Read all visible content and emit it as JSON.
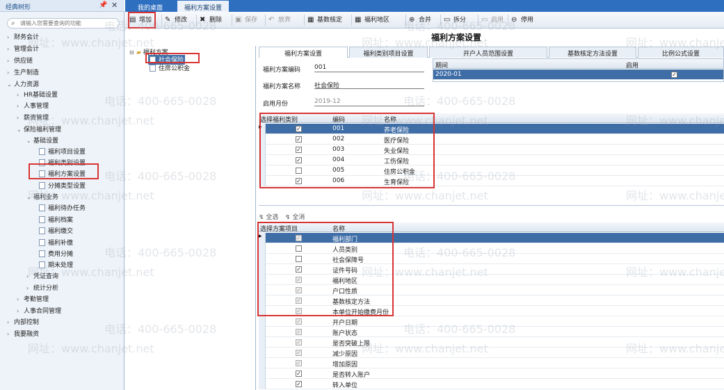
{
  "left_panel": {
    "title": "经典树形",
    "pin_icon": "pin-icon",
    "close_icon": "close-icon",
    "search_placeholder": "请输入您需要查询的功能",
    "tree": [
      {
        "label": "财务会计",
        "arrow": "›"
      },
      {
        "label": "管理会计",
        "arrow": "›"
      },
      {
        "label": "供应链",
        "arrow": "›"
      },
      {
        "label": "生产制造",
        "arrow": "›"
      },
      {
        "label": "人力资源",
        "arrow": "⌄"
      },
      {
        "label": "HR基础设置",
        "arrow": "›"
      },
      {
        "label": "人事管理",
        "arrow": "›"
      },
      {
        "label": "薪资管理",
        "arrow": "›"
      },
      {
        "label": "保险福利管理",
        "arrow": "⌄"
      },
      {
        "label": "基础设置",
        "arrow": "⌄"
      },
      {
        "label": "福利项目设置",
        "arrow": ""
      },
      {
        "label": "福利类别设置",
        "arrow": ""
      },
      {
        "label": "福利方案设置",
        "arrow": ""
      },
      {
        "label": "分摊类型设置",
        "arrow": ""
      },
      {
        "label": "福利业务",
        "arrow": "⌄"
      },
      {
        "label": "福利待办任务",
        "arrow": ""
      },
      {
        "label": "福利档案",
        "arrow": ""
      },
      {
        "label": "福利缴交",
        "arrow": ""
      },
      {
        "label": "福利补缴",
        "arrow": ""
      },
      {
        "label": "费用分摊",
        "arrow": ""
      },
      {
        "label": "期末处理",
        "arrow": ""
      },
      {
        "label": "凭证查询",
        "arrow": "›"
      },
      {
        "label": "统计分析",
        "arrow": "›"
      },
      {
        "label": "考勤管理",
        "arrow": "›"
      },
      {
        "label": "人事合同管理",
        "arrow": "›"
      },
      {
        "label": "内部控制",
        "arrow": "›"
      },
      {
        "label": "我要融资",
        "arrow": "›"
      }
    ]
  },
  "tabs": [
    "我的桌面",
    "福利方案设置"
  ],
  "toolbar": [
    {
      "label": "增加",
      "icon": "add-icon",
      "glyph": "▤",
      "enabled": true
    },
    {
      "label": "修改",
      "icon": "edit-icon",
      "glyph": "✎",
      "enabled": true
    },
    {
      "label": "删除",
      "icon": "delete-icon",
      "glyph": "✖",
      "enabled": true
    },
    {
      "label": "保存",
      "icon": "save-icon",
      "glyph": "▣",
      "enabled": false
    },
    {
      "label": "放弃",
      "icon": "discard-icon",
      "glyph": "↶",
      "enabled": false
    },
    {
      "label": "基数核定",
      "icon": "base-check-icon",
      "glyph": "▦",
      "enabled": true
    },
    {
      "label": "福利地区",
      "icon": "region-icon",
      "glyph": "▦",
      "enabled": true
    },
    {
      "label": "合并",
      "icon": "merge-icon",
      "glyph": "⊕",
      "enabled": true
    },
    {
      "label": "拆分",
      "icon": "split-icon",
      "glyph": "▭",
      "enabled": true
    },
    {
      "label": "启用",
      "icon": "enable-icon",
      "glyph": "▭",
      "enabled": false
    },
    {
      "label": "停用",
      "icon": "disable-icon",
      "glyph": "⊖",
      "enabled": true
    }
  ],
  "scheme_tree": {
    "root": "福利方案",
    "children": [
      "社会保险",
      "住房公积金"
    ]
  },
  "page_title": "福利方案设置",
  "sub_tabs": [
    "福利方案设置",
    "福利类别项目设置",
    "开户人员范围设置",
    "基数核定方法设置",
    "比例公式设置"
  ],
  "form": {
    "code_label": "福利方案编码",
    "code_value": "001",
    "name_label": "福利方案名称",
    "name_value": "社会保险",
    "month_label": "启用月份",
    "month_value": "2019-12"
  },
  "period_grid": {
    "headers": [
      "期间",
      "启用"
    ],
    "rows": [
      {
        "period": "2020-01",
        "enabled": true
      }
    ]
  },
  "category_grid": {
    "headers": [
      "选择福利类别",
      "编码",
      "名称"
    ],
    "rows": [
      {
        "checked": true,
        "code": "001",
        "name": "养老保险"
      },
      {
        "checked": true,
        "code": "002",
        "name": "医疗保险"
      },
      {
        "checked": true,
        "code": "003",
        "name": "失业保险"
      },
      {
        "checked": true,
        "code": "004",
        "name": "工伤保险"
      },
      {
        "checked": false,
        "code": "005",
        "name": "住房公积金"
      },
      {
        "checked": true,
        "code": "006",
        "name": "生育保险"
      }
    ]
  },
  "select_all_label": "全选",
  "clear_all_label": "全消",
  "item_grid": {
    "headers": [
      "选择方案项目",
      "名称"
    ],
    "rows": [
      {
        "checked": true,
        "dim": true,
        "name": "福利部门"
      },
      {
        "checked": false,
        "dim": false,
        "name": "人员类别"
      },
      {
        "checked": false,
        "dim": false,
        "name": "社会保障号"
      },
      {
        "checked": true,
        "dim": false,
        "name": "证件号码"
      },
      {
        "checked": true,
        "dim": true,
        "name": "福利地区"
      },
      {
        "checked": true,
        "dim": true,
        "name": "户口性质"
      },
      {
        "checked": true,
        "dim": true,
        "name": "基数核定方法"
      },
      {
        "checked": true,
        "dim": true,
        "name": "本单位开始缴费月份"
      },
      {
        "checked": true,
        "dim": true,
        "name": "开户日期"
      },
      {
        "checked": true,
        "dim": true,
        "name": "账户状态"
      },
      {
        "checked": true,
        "dim": true,
        "name": "是否突破上限"
      },
      {
        "checked": true,
        "dim": true,
        "name": "减少原因"
      },
      {
        "checked": true,
        "dim": true,
        "name": "增加原因"
      },
      {
        "checked": true,
        "dim": false,
        "name": "是否转入账户"
      },
      {
        "checked": true,
        "dim": false,
        "name": "转入单位"
      }
    ]
  },
  "watermarks": {
    "phone": "电话：400-665-0028",
    "url": "网址：www.chanjet.net"
  }
}
